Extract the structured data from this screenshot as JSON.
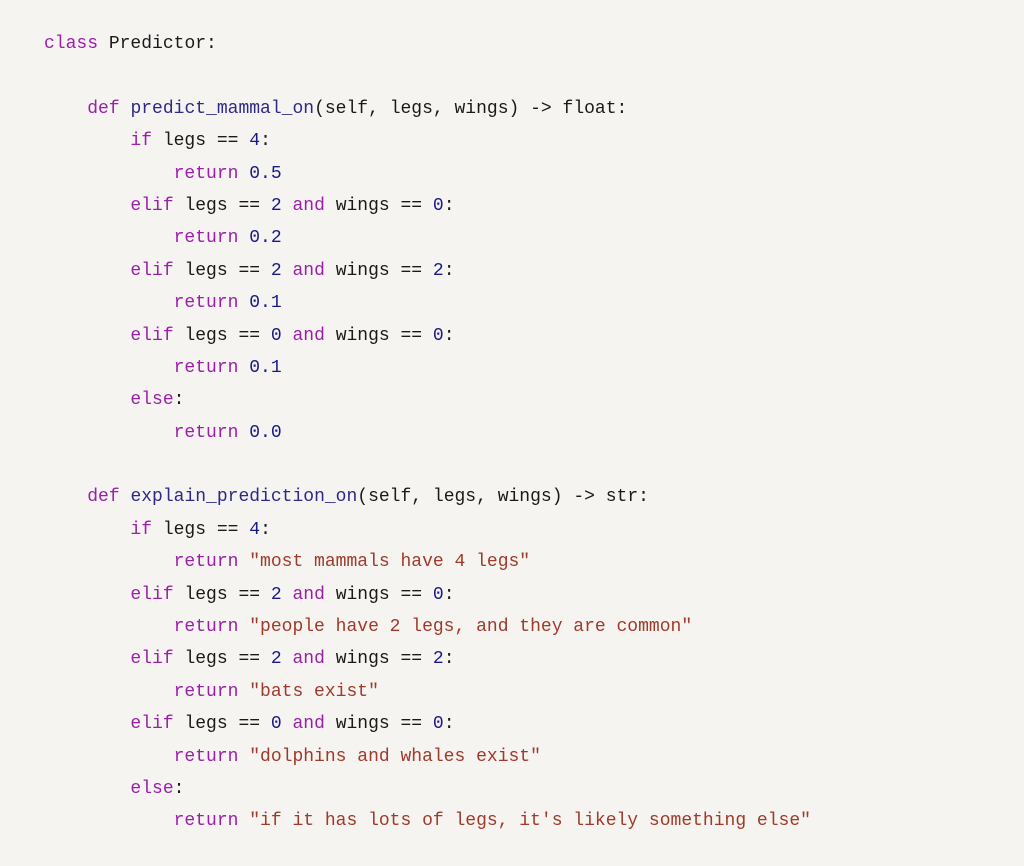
{
  "kw": {
    "class": "class",
    "def": "def",
    "if": "if",
    "elif": "elif",
    "else": "else",
    "return": "return",
    "and": "and"
  },
  "cls": {
    "name": "Predictor"
  },
  "m1": {
    "name": "predict_mammal_on",
    "params_open": "(self, legs, wings) -> ",
    "ret_type": "float",
    "close": ":"
  },
  "m2": {
    "name": "explain_prediction_on",
    "params_open": "(self, legs, wings) -> ",
    "ret_type": "str",
    "close": ":"
  },
  "cond": {
    "legs4": " legs == ",
    "legs2_wings0_a": " legs == ",
    "legs2_wings0_b": " wings == ",
    "legs2_wings2_a": " legs == ",
    "legs2_wings2_b": " wings == ",
    "legs0_wings0_a": " legs == ",
    "legs0_wings0_b": " wings == "
  },
  "n": {
    "four": "4",
    "two": "2",
    "zero": "0",
    "p05": "0.5",
    "p02": "0.2",
    "p01a": "0.1",
    "p01b": "0.1",
    "p00": "0.0"
  },
  "s": {
    "s1": "\"most mammals have 4 legs\"",
    "s2": "\"people have 2 legs, and they are common\"",
    "s3": "\"bats exist\"",
    "s4": "\"dolphins and whales exist\"",
    "s5": "\"if it has lots of legs, it's likely something else\""
  },
  "colon": ":",
  "space": " "
}
